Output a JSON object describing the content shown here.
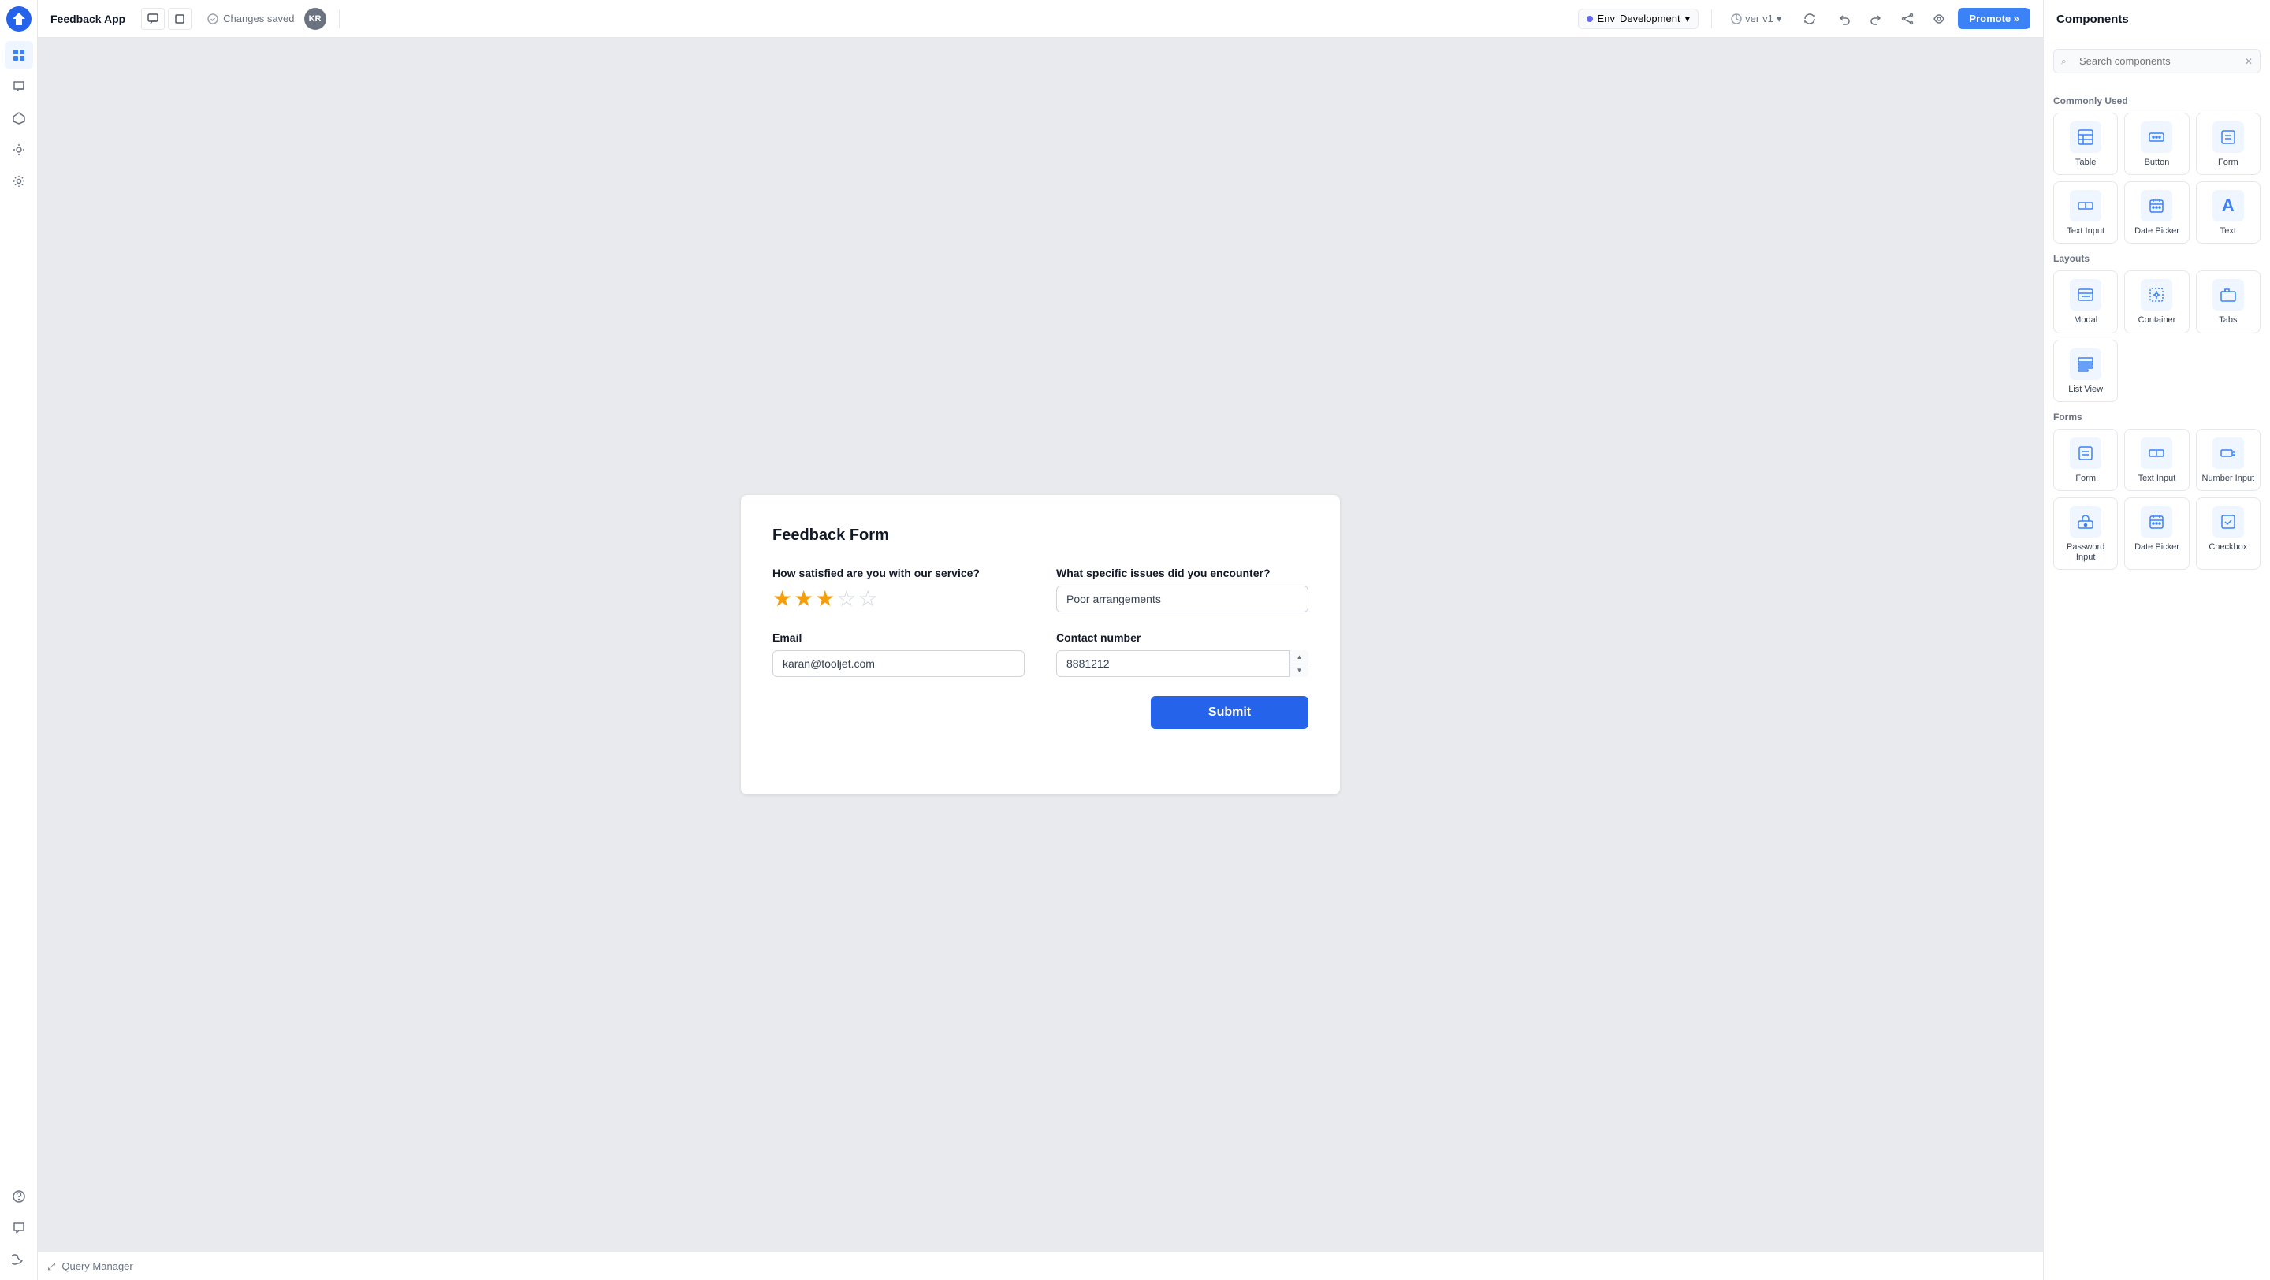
{
  "app": {
    "title": "Feedback App",
    "status": "Changes saved",
    "env_label": "Env",
    "env_value": "Development",
    "ver_label": "ver",
    "ver_value": "v1",
    "promote_label": "Promote »",
    "user_initials": "KR"
  },
  "toolbar": {
    "comment_icon": "💬",
    "layers_icon": "⊟"
  },
  "form": {
    "title": "Feedback Form",
    "satisfaction_label": "How satisfied are you with our service?",
    "stars_filled": 3,
    "stars_empty": 2,
    "issues_label": "What specific issues did you encounter?",
    "issues_value": "Poor arrangements",
    "email_label": "Email",
    "email_value": "karan@tooljet.com",
    "contact_label": "Contact number",
    "contact_value": "8881212",
    "submit_label": "Submit"
  },
  "bottom_bar": {
    "query_manager_label": "Query Manager"
  },
  "panel": {
    "title": "Components",
    "search_placeholder": "Search components",
    "commonly_used_label": "Commonly Used",
    "layouts_label": "Layouts",
    "forms_label": "Forms",
    "components": {
      "commonly_used": [
        {
          "name": "Table",
          "icon": "⊞"
        },
        {
          "name": "Button",
          "icon": "⋯"
        },
        {
          "name": "Form",
          "icon": "≡"
        },
        {
          "name": "Text Input",
          "icon": "I"
        },
        {
          "name": "Date Picker",
          "icon": "📅"
        },
        {
          "name": "Text",
          "icon": "A"
        }
      ],
      "layouts": [
        {
          "name": "Modal",
          "icon": "⧉"
        },
        {
          "name": "Container",
          "icon": "⊕"
        },
        {
          "name": "Tabs",
          "icon": "⊟"
        },
        {
          "name": "List View",
          "icon": "≣"
        }
      ],
      "forms": [
        {
          "name": "Form",
          "icon": "≡"
        },
        {
          "name": "Text Input",
          "icon": "I"
        },
        {
          "name": "Number Input",
          "icon": "1"
        },
        {
          "name": "Password Input",
          "icon": "🔒"
        },
        {
          "name": "Date Picker",
          "icon": "📅"
        },
        {
          "name": "Checkbox",
          "icon": "✓"
        }
      ]
    }
  }
}
